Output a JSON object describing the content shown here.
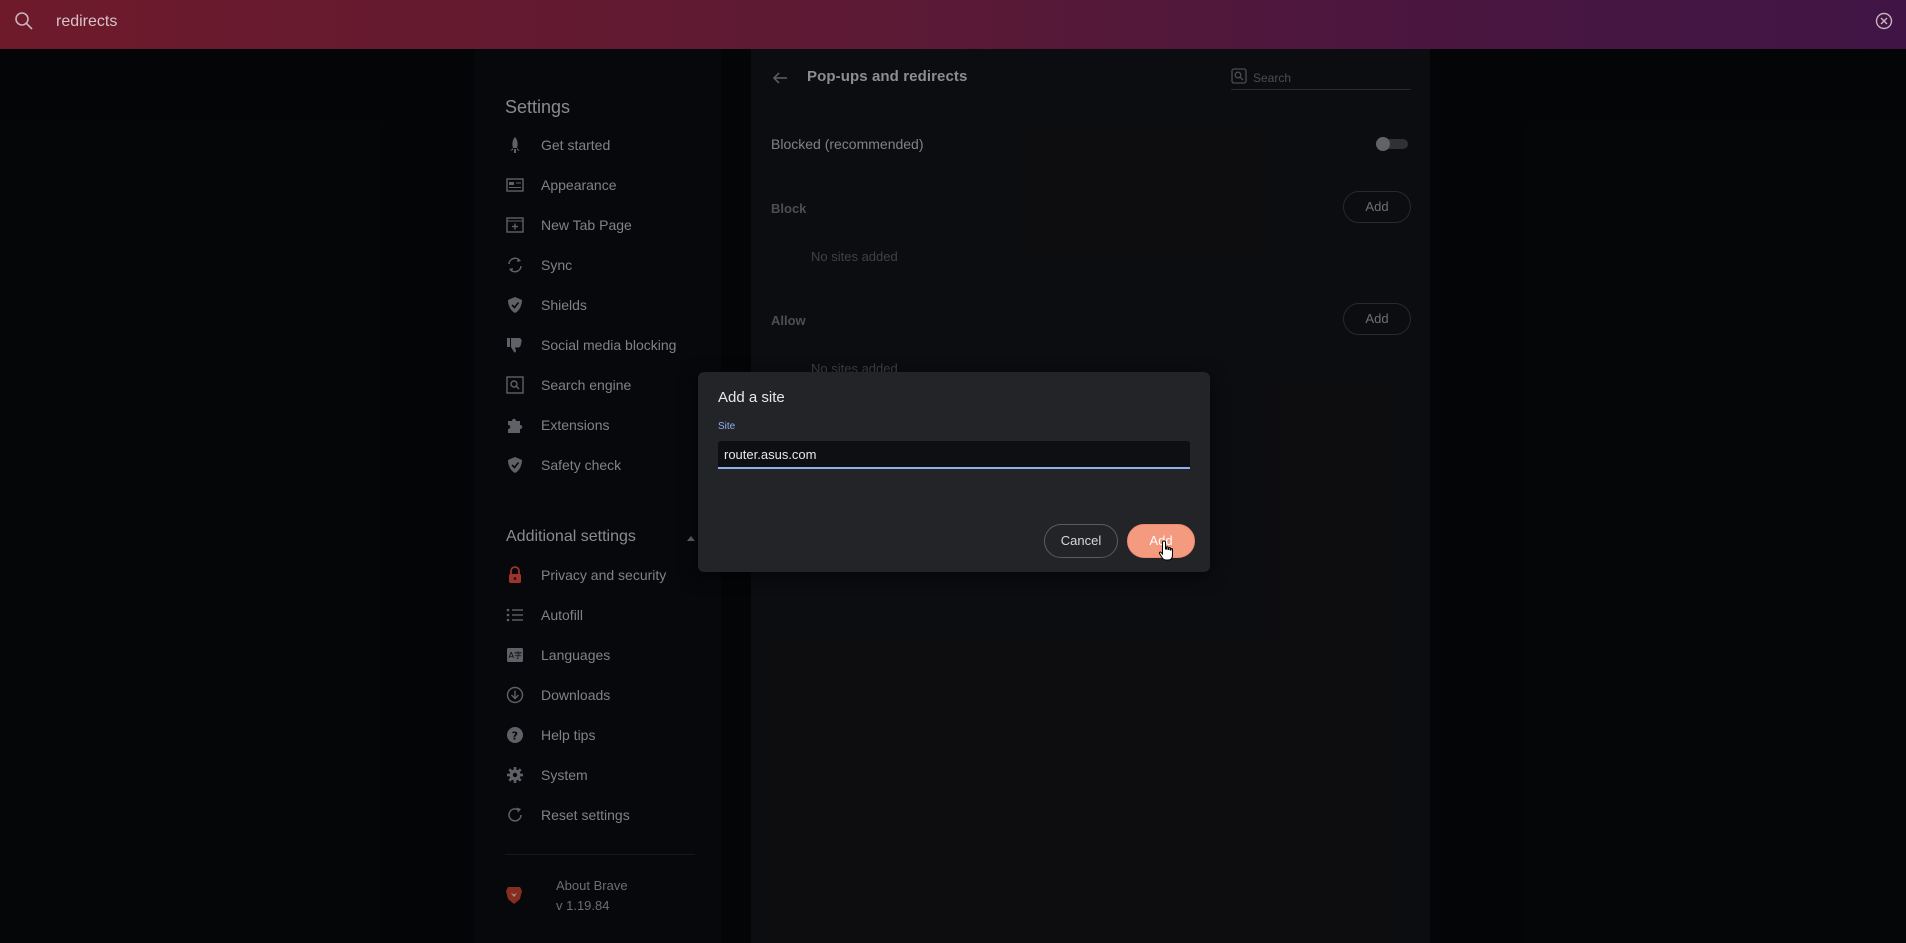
{
  "top_search": {
    "value": "redirects"
  },
  "sidebar": {
    "title": "Settings",
    "items": [
      {
        "label": "Get started",
        "icon": "rocket-icon"
      },
      {
        "label": "Appearance",
        "icon": "appearance-icon"
      },
      {
        "label": "New Tab Page",
        "icon": "new-tab-icon"
      },
      {
        "label": "Sync",
        "icon": "sync-icon"
      },
      {
        "label": "Shields",
        "icon": "shield-icon"
      },
      {
        "label": "Social media blocking",
        "icon": "thumbs-down-icon"
      },
      {
        "label": "Search engine",
        "icon": "search-engine-icon"
      },
      {
        "label": "Extensions",
        "icon": "puzzle-icon"
      },
      {
        "label": "Safety check",
        "icon": "shield-check-icon"
      }
    ],
    "additional_label": "Additional settings",
    "additional_items": [
      {
        "label": "Privacy and security",
        "icon": "lock-icon"
      },
      {
        "label": "Autofill",
        "icon": "list-icon"
      },
      {
        "label": "Languages",
        "icon": "language-icon"
      },
      {
        "label": "Downloads",
        "icon": "download-icon"
      },
      {
        "label": "Help tips",
        "icon": "help-icon"
      },
      {
        "label": "System",
        "icon": "gear-icon"
      },
      {
        "label": "Reset settings",
        "icon": "reset-icon"
      }
    ],
    "about": {
      "name": "About Brave",
      "version": "v 1.19.84"
    }
  },
  "main": {
    "title": "Pop-ups and redirects",
    "search_placeholder": "Search",
    "blocked_label": "Blocked (recommended)",
    "block_label": "Block",
    "allow_label": "Allow",
    "add_label": "Add",
    "no_sites": "No sites added"
  },
  "dialog": {
    "title": "Add a site",
    "field_label": "Site",
    "field_value": "router.asus.com",
    "cancel_label": "Cancel",
    "add_label": "Add"
  },
  "colors": {
    "accent": "#f49a7e",
    "focus": "#8fb0ee",
    "topbar_left": "#6e1a2b",
    "topbar_right": "#401545"
  }
}
